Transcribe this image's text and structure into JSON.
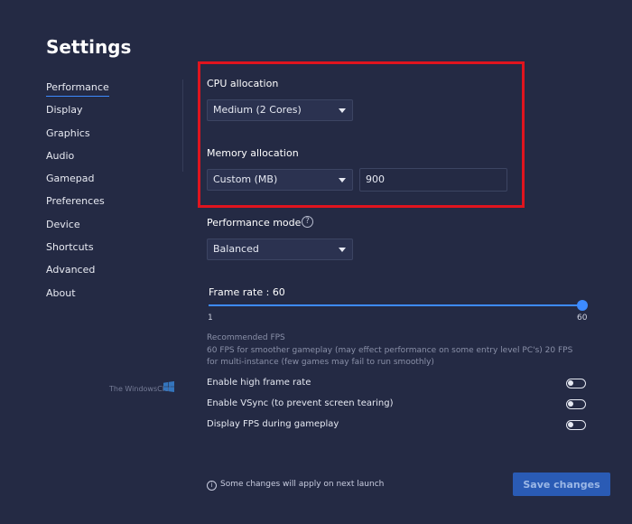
{
  "page": {
    "title": "Settings"
  },
  "nav": [
    {
      "label": "Performance",
      "active": true
    },
    {
      "label": "Display"
    },
    {
      "label": "Graphics"
    },
    {
      "label": "Audio"
    },
    {
      "label": "Gamepad"
    },
    {
      "label": "Preferences"
    },
    {
      "label": "Device"
    },
    {
      "label": "Shortcuts"
    },
    {
      "label": "Advanced"
    },
    {
      "label": "About"
    }
  ],
  "cpu": {
    "label": "CPU allocation",
    "value": "Medium (2 Cores)"
  },
  "memory": {
    "label": "Memory allocation",
    "mode": "Custom (MB)",
    "value": "900"
  },
  "perf_mode": {
    "label": "Performance mode",
    "value": "Balanced",
    "help_glyph": "?"
  },
  "frame_rate": {
    "label": "Frame rate : 60",
    "value": 60,
    "min": 1,
    "max": 60,
    "min_label": "1",
    "max_label": "60"
  },
  "recommended": {
    "heading": "Recommended FPS",
    "text": "60 FPS for smoother gameplay (may effect performance on some entry level PC's) 20 FPS for multi-instance (few games may fail to run smoothly)"
  },
  "toggles": [
    {
      "label": "Enable high frame rate",
      "on": false
    },
    {
      "label": "Enable VSync (to prevent screen tearing)",
      "on": false
    },
    {
      "label": "Display FPS during gameplay",
      "on": false
    }
  ],
  "watermark": {
    "text": "The WindowsClub",
    "icon": "windows-logo-icon"
  },
  "footer": {
    "note": "Some changes will apply on next launch",
    "info_glyph": "i",
    "save_label": "Save changes"
  },
  "colors": {
    "background": "#242a44",
    "accent": "#3d8bff",
    "highlight": "#e0141e",
    "button": "#2a5bb5"
  }
}
